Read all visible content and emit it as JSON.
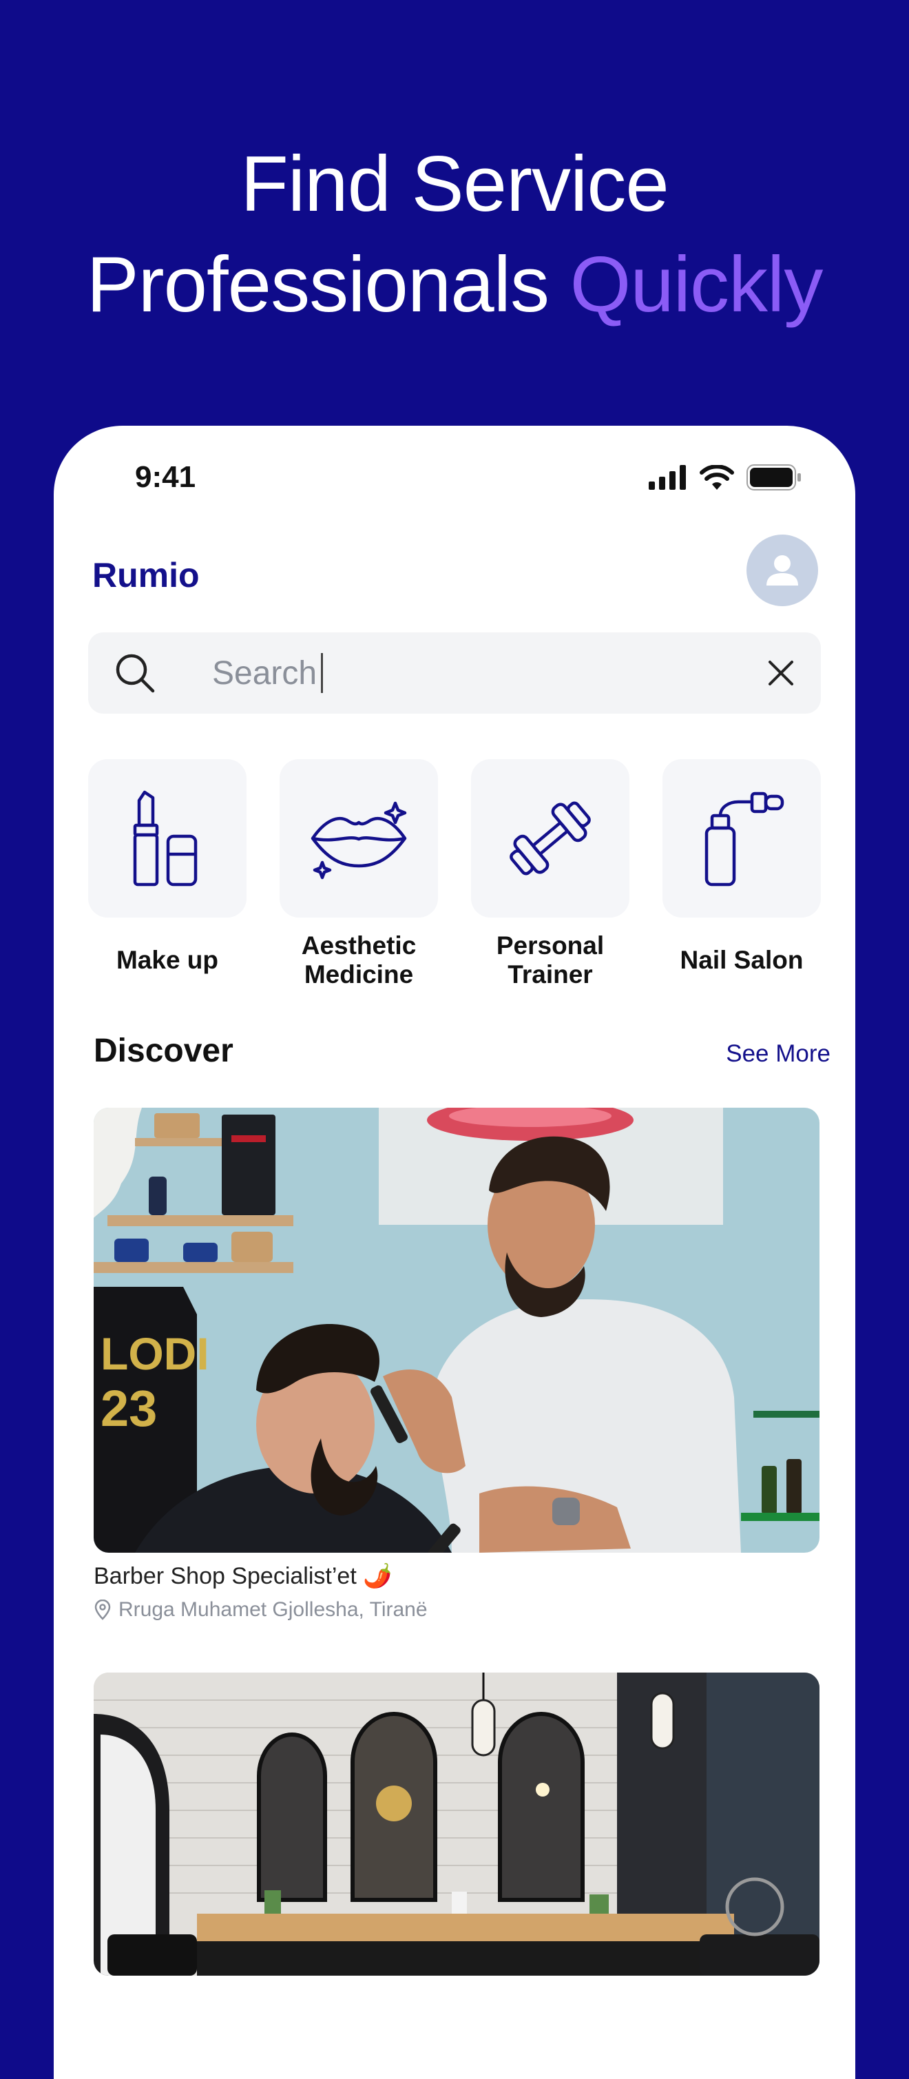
{
  "headline": {
    "line1": "Find Service",
    "line2_prefix": "Professionals",
    "line2_accent": "Quickly"
  },
  "colors": {
    "background": "#0f0b8a",
    "accent": "#8b5cf6",
    "brand": "#13108b"
  },
  "status_bar": {
    "time": "9:41",
    "icons": [
      "signal-icon",
      "wifi-icon",
      "battery-icon"
    ]
  },
  "app": {
    "name": "Rumio",
    "avatar_icon": "user-icon"
  },
  "search": {
    "placeholder": "Search",
    "value": ""
  },
  "categories": [
    {
      "label": "Make up",
      "icon": "lipstick-icon"
    },
    {
      "label": "Aesthetic Medicine",
      "icon": "lips-icon"
    },
    {
      "label": "Personal Trainer",
      "icon": "dumbbell-icon"
    },
    {
      "label": "Nail Salon",
      "icon": "nail-polish-icon"
    }
  ],
  "discover": {
    "title": "Discover",
    "see_more": "See More",
    "cards": [
      {
        "title": "Barber Shop Specialist’et 🌶️",
        "location": "Rruga Muhamet Gjollesha, Tiranë"
      },
      {
        "title": "",
        "location": ""
      }
    ]
  }
}
